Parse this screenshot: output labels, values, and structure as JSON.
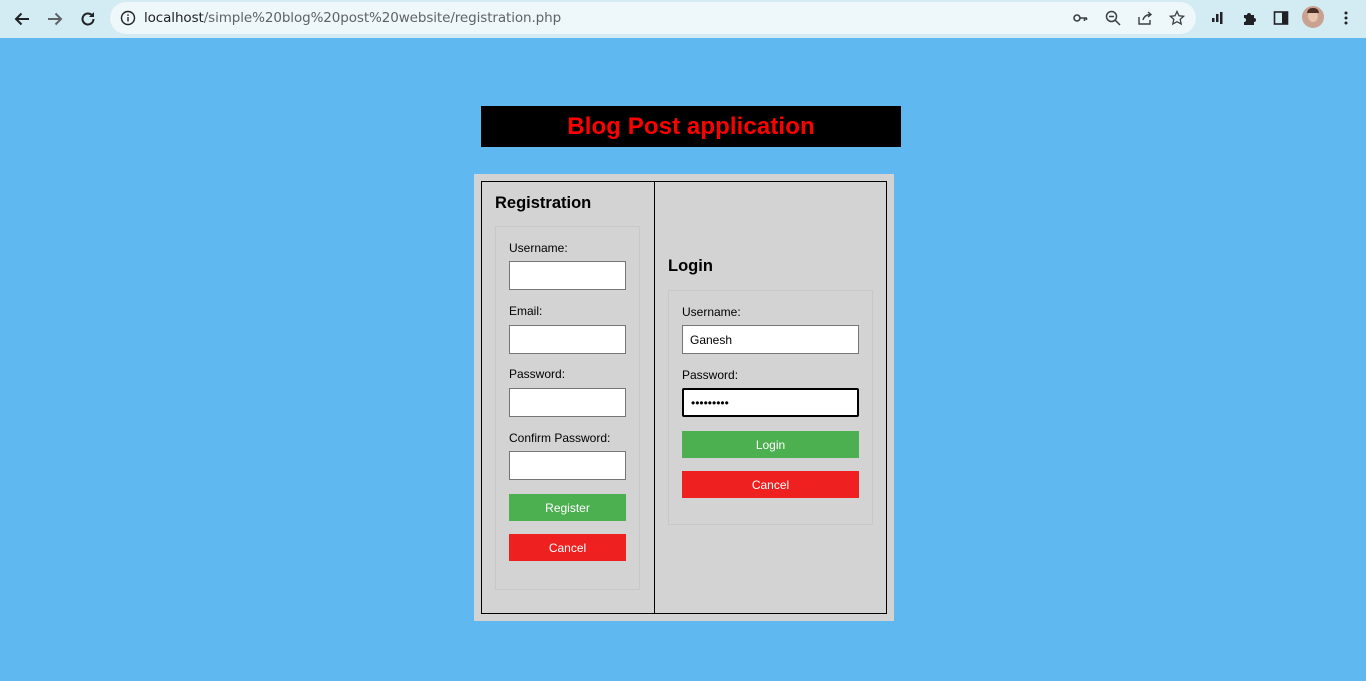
{
  "browser": {
    "url_host": "localhost",
    "url_path": "/simple%20blog%20post%20website/registration.php"
  },
  "page": {
    "title": "Blog Post application"
  },
  "registration": {
    "heading": "Registration",
    "username_label": "Username:",
    "username_value": "",
    "email_label": "Email:",
    "email_value": "",
    "password_label": "Password:",
    "password_value": "",
    "confirm_label": "Confirm Password:",
    "confirm_value": "",
    "register_button": "Register",
    "cancel_button": "Cancel"
  },
  "login": {
    "heading": "Login",
    "username_label": "Username:",
    "username_value": "Ganesh",
    "password_label": "Password:",
    "password_value": "•••••••••",
    "login_button": "Login",
    "cancel_button": "Cancel"
  },
  "colors": {
    "page_background": "#5fb8f0",
    "banner_text": "#ff0000",
    "login_green": "#4caf50",
    "cancel_red": "#ef2020"
  }
}
